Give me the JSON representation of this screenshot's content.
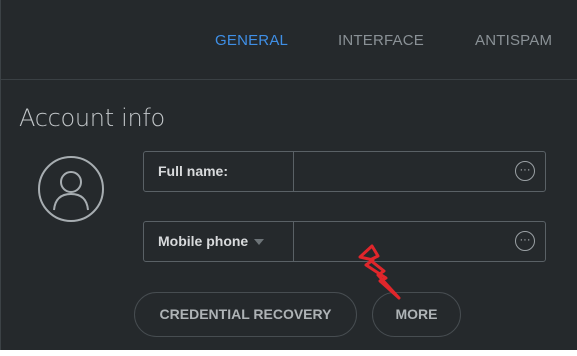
{
  "tabs": [
    {
      "label": "GENERAL",
      "active": true
    },
    {
      "label": "INTERFACE",
      "active": false
    },
    {
      "label": "ANTISPAM",
      "active": false
    }
  ],
  "account": {
    "title": "Account info",
    "full_name_label": "Full name:",
    "full_name_value": "",
    "phone_label": "Mobile phone",
    "phone_value": ""
  },
  "buttons": {
    "credential_recovery": "CREDENTIAL RECOVERY",
    "more": "MORE"
  },
  "icons": {
    "avatar": "user-avatar-icon",
    "options": "ellipsis-circle-icon",
    "dropdown": "caret-down-icon",
    "annotation": "red-zigzag-arrow-icon"
  },
  "colors": {
    "background": "#25292c",
    "active_tab": "#3f8fe6",
    "inactive_tab": "#8a9196",
    "annotation": "#e0262b"
  }
}
